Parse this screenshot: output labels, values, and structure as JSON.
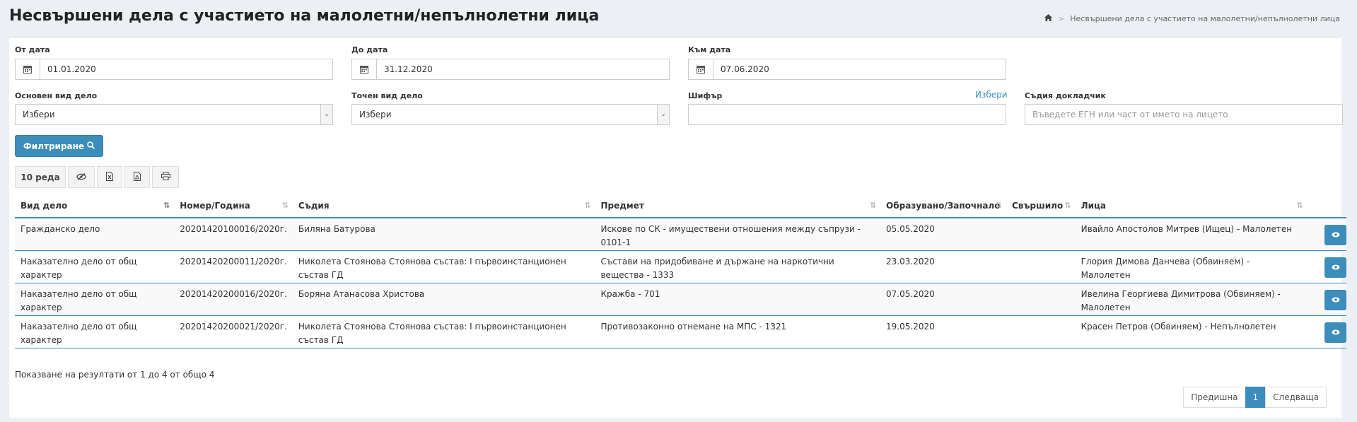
{
  "page": {
    "title": "Несвършени дела с участието на малолетни/непълнолетни лица",
    "breadcrumb": {
      "home_icon": "home-icon",
      "current": "Несвършени дела с участието на малолетни/непълнолетни лица"
    }
  },
  "filters": {
    "from_date": {
      "label": "От дата",
      "value": "01.01.2020"
    },
    "to_date": {
      "label": "До дата",
      "value": "31.12.2020"
    },
    "as_of_date": {
      "label": "Към дата",
      "value": "07.06.2020"
    },
    "main_case_type": {
      "label": "Основен вид дело",
      "value": "Избери"
    },
    "exact_case_type": {
      "label": "Точен вид дело",
      "value": "Избери"
    },
    "code": {
      "label": "Шифър",
      "link": "Избери",
      "value": ""
    },
    "judge": {
      "label": "Съдия докладчик",
      "placeholder": "Въведете ЕГН или част от името на лицето"
    },
    "filter_button": "Филтриране"
  },
  "toolbar": {
    "rows_label": "10 реда"
  },
  "table": {
    "headers": [
      "Вид дело",
      "Номер/Година",
      "Съдия",
      "Предмет",
      "Образувано/Започнало",
      "Свършило",
      "Лица"
    ],
    "rows": [
      {
        "type": "Гражданско дело",
        "number": "20201420100016/2020г.",
        "judge": "Биляна Батурова",
        "subject": "Искове по СК - имуществени отношения между съпрузи - 0101-1",
        "started": "05.05.2020",
        "finished": "",
        "persons": "Ивайло Апостолов Митрев (Ищец) - Малолетен"
      },
      {
        "type": "Наказателно дело от общ характер",
        "number": "20201420200011/2020г.",
        "judge": "Николета Стоянова Стоянова състав: I първоинстанционен състав ГД",
        "subject": "Състави на придобиване и държане на наркотични вещества - 1333",
        "started": "23.03.2020",
        "finished": "",
        "persons": "Глория Димова Данчева (Обвиняем) - Малолетен"
      },
      {
        "type": "Наказателно дело от общ характер",
        "number": "20201420200016/2020г.",
        "judge": "Боряна Атанасова Христова",
        "subject": "Кражба - 701",
        "started": "07.05.2020",
        "finished": "",
        "persons": "Ивелина Георгиева Димитрова (Обвиняем) - Малолетен"
      },
      {
        "type": "Наказателно дело от общ характер",
        "number": "20201420200021/2020г.",
        "judge": "Николета Стоянова Стоянова състав: I първоинстанционен състав ГД",
        "subject": "Противозаконно отнемане на МПС - 1321",
        "started": "19.05.2020",
        "finished": "",
        "persons": "Красен Петров (Обвиняем) - Непълнолетен"
      }
    ]
  },
  "footer": {
    "info": "Показване на резултати от 1 до 4 от общо 4",
    "prev": "Предишна",
    "page": "1",
    "next": "Следваща"
  }
}
